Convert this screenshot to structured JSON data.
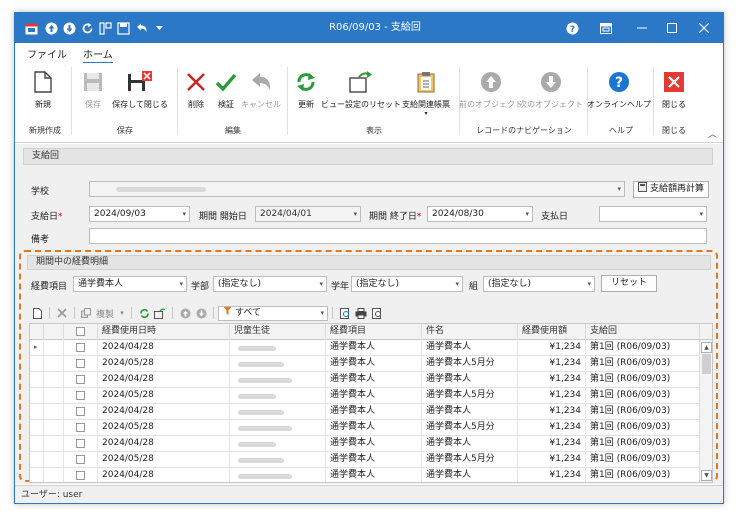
{
  "window": {
    "title": "R06/09/03 - 支給回"
  },
  "menu": {
    "tabs": [
      "ファイル",
      "ホーム"
    ]
  },
  "ribbon": {
    "buttons": {
      "new": "新規",
      "save": "保存",
      "save_close": "保存して閉じる",
      "delete": "削除",
      "verify": "検証",
      "cancel": "キャンセル",
      "refresh": "更新",
      "view_reset": "ビュー設定のリセット",
      "related_forms": "支給関連帳票",
      "prev_object": "前のオブジェクト",
      "next_object": "次のオブジェクト",
      "online_help": "オンラインヘルプ",
      "close": "閉じる"
    },
    "groups": {
      "new": "新規作成",
      "save": "保存",
      "edit": "編集",
      "view": "表示",
      "nav": "レコードのナビゲーション",
      "help": "ヘルプ",
      "close": "閉じる"
    }
  },
  "header_panel": {
    "title": "支給回",
    "school_label": "学校",
    "recalc_button": "支給額再計算",
    "pay_date_label": "支給日",
    "pay_date_value": "2024/09/03",
    "period_start_label": "期間 開始日",
    "period_start_value": "2024/04/01",
    "period_end_label": "期間 終了日",
    "period_end_value": "2024/08/30",
    "payment_date_label": "支払日",
    "payment_date_value": "",
    "note_label": "備考",
    "note_value": ""
  },
  "detail_panel": {
    "title": "期間中の経費明細",
    "filters": {
      "expense_item_label": "経費項目",
      "expense_item_value": "通学費本人",
      "department_label": "学部",
      "department_value": "(指定なし)",
      "grade_label": "学年",
      "grade_value": "(指定なし)",
      "class_label": "組",
      "class_value": "(指定なし)",
      "reset_button": "リセット"
    },
    "toolbar": {
      "copy_label": "複製",
      "filter_value": "すべて"
    },
    "columns": [
      "経費使用日時",
      "児童生徒",
      "経費項目",
      "件名",
      "経費使用額",
      "支給回"
    ],
    "rows": [
      {
        "date": "2024/04/28",
        "item": "通学費本人",
        "subject": "通学費本人",
        "amount": "¥1,234",
        "round": "第1回 (R06/09/03)"
      },
      {
        "date": "2024/05/28",
        "item": "通学費本人",
        "subject": "通学費本人5月分",
        "amount": "¥1,234",
        "round": "第1回 (R06/09/03)"
      },
      {
        "date": "2024/04/28",
        "item": "通学費本人",
        "subject": "通学費本人",
        "amount": "¥1,234",
        "round": "第1回 (R06/09/03)"
      },
      {
        "date": "2024/05/28",
        "item": "通学費本人",
        "subject": "通学費本人5月分",
        "amount": "¥1,234",
        "round": "第1回 (R06/09/03)"
      },
      {
        "date": "2024/04/28",
        "item": "通学費本人",
        "subject": "通学費本人",
        "amount": "¥1,234",
        "round": "第1回 (R06/09/03)"
      },
      {
        "date": "2024/05/28",
        "item": "通学費本人",
        "subject": "通学費本人5月分",
        "amount": "¥1,234",
        "round": "第1回 (R06/09/03)"
      },
      {
        "date": "2024/04/28",
        "item": "通学費本人",
        "subject": "通学費本人",
        "amount": "¥1,234",
        "round": "第1回 (R06/09/03)"
      },
      {
        "date": "2024/05/28",
        "item": "通学費本人",
        "subject": "通学費本人5月分",
        "amount": "¥1,234",
        "round": "第1回 (R06/09/03)"
      },
      {
        "date": "2024/04/28",
        "item": "通学費本人",
        "subject": "通学費本人",
        "amount": "¥1,234",
        "round": "第1回 (R06/09/03)"
      }
    ]
  },
  "status": {
    "user_text": "ユーザー: user"
  },
  "colors": {
    "titlebar": "#2b78c6",
    "highlight_dash": "#e2781e",
    "delete_red": "#c62828",
    "verify_green": "#2e9a3a",
    "refresh_green": "#2e9a3a",
    "help_blue": "#1976d2",
    "close_red": "#e53935"
  }
}
